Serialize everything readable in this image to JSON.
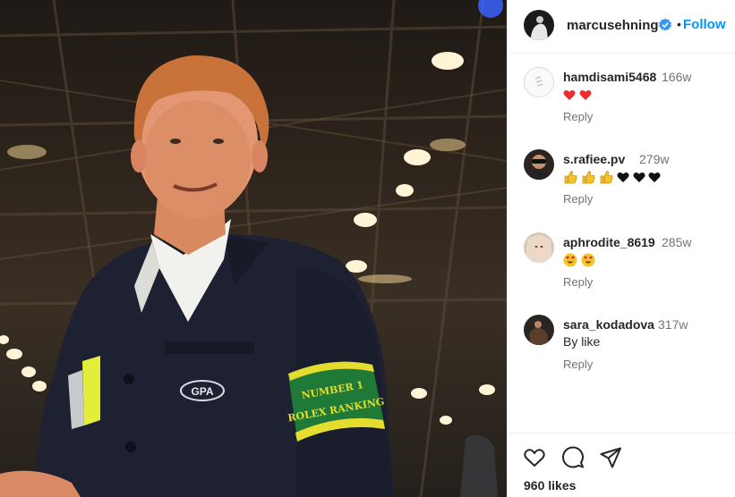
{
  "post": {
    "owner": {
      "username": "marcusehning",
      "verified": true,
      "separator": "•",
      "follow_label": "Follow"
    },
    "photo": {
      "armband_text_line1": "NUMBER 1",
      "armband_text_line2": "ROLEX RANKING",
      "jacket_logo": "GPA"
    },
    "comments": [
      {
        "username": "hamdisami5468",
        "time": "166w",
        "text": "",
        "emoji": [
          "red-heart",
          "red-heart"
        ],
        "reply_label": "Reply"
      },
      {
        "username": "s.rafiee.pv",
        "time": "279w",
        "text": "",
        "emoji": [
          "thumbs-up",
          "thumbs-up",
          "thumbs-up",
          "black-heart",
          "black-heart",
          "black-heart"
        ],
        "reply_label": "Reply"
      },
      {
        "username": "aphrodite_8619",
        "time": "285w",
        "text": "",
        "emoji": [
          "heart-eyes",
          "heart-eyes"
        ],
        "reply_label": "Reply"
      },
      {
        "username": "sara_kodadova",
        "time": "317w",
        "text": "By like",
        "emoji": [],
        "reply_label": "Reply"
      }
    ],
    "likes_text": "960 likes",
    "colors": {
      "accent": "#0095f6",
      "verified": "#3897f0",
      "heart_red": "#ed4956"
    }
  }
}
